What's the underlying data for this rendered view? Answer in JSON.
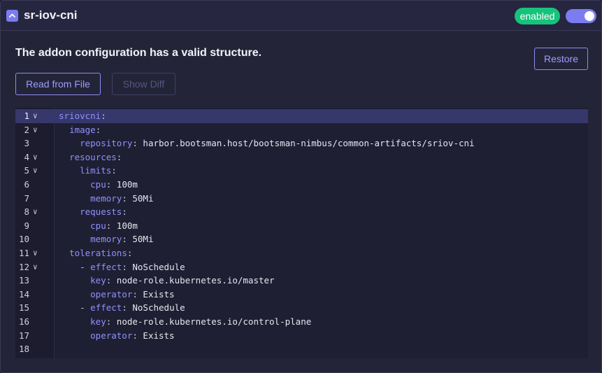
{
  "header": {
    "title": "sr-iov-cni",
    "status_badge": "enabled",
    "toggle_on": true
  },
  "message": "The addon configuration has a valid structure.",
  "buttons": {
    "restore": "Restore",
    "read_from_file": "Read from File",
    "show_diff": "Show Diff"
  },
  "editor": {
    "lines": [
      {
        "n": "1",
        "fold": true,
        "indent": "",
        "dash": "",
        "key": "sriovcni",
        "value": ""
      },
      {
        "n": "2",
        "fold": true,
        "indent": "  ",
        "dash": "",
        "key": "image",
        "value": ""
      },
      {
        "n": "3",
        "fold": false,
        "indent": "    ",
        "dash": "",
        "key": "repository",
        "value": "harbor.bootsman.host/bootsman-nimbus/common-artifacts/sriov-cni"
      },
      {
        "n": "4",
        "fold": true,
        "indent": "  ",
        "dash": "",
        "key": "resources",
        "value": ""
      },
      {
        "n": "5",
        "fold": true,
        "indent": "    ",
        "dash": "",
        "key": "limits",
        "value": ""
      },
      {
        "n": "6",
        "fold": false,
        "indent": "      ",
        "dash": "",
        "key": "cpu",
        "value": "100m"
      },
      {
        "n": "7",
        "fold": false,
        "indent": "      ",
        "dash": "",
        "key": "memory",
        "value": "50Mi"
      },
      {
        "n": "8",
        "fold": true,
        "indent": "    ",
        "dash": "",
        "key": "requests",
        "value": ""
      },
      {
        "n": "9",
        "fold": false,
        "indent": "      ",
        "dash": "",
        "key": "cpu",
        "value": "100m"
      },
      {
        "n": "10",
        "fold": false,
        "indent": "      ",
        "dash": "",
        "key": "memory",
        "value": "50Mi"
      },
      {
        "n": "11",
        "fold": true,
        "indent": "  ",
        "dash": "",
        "key": "tolerations",
        "value": ""
      },
      {
        "n": "12",
        "fold": true,
        "indent": "    ",
        "dash": "- ",
        "key": "effect",
        "value": "NoSchedule"
      },
      {
        "n": "13",
        "fold": false,
        "indent": "      ",
        "dash": "",
        "key": "key",
        "value": "node-role.kubernetes.io/master"
      },
      {
        "n": "14",
        "fold": false,
        "indent": "      ",
        "dash": "",
        "key": "operator",
        "value": "Exists"
      },
      {
        "n": "15",
        "fold": false,
        "indent": "    ",
        "dash": "- ",
        "key": "effect",
        "value": "NoSchedule"
      },
      {
        "n": "16",
        "fold": false,
        "indent": "      ",
        "dash": "",
        "key": "key",
        "value": "node-role.kubernetes.io/control-plane"
      },
      {
        "n": "17",
        "fold": false,
        "indent": "      ",
        "dash": "",
        "key": "operator",
        "value": "Exists"
      },
      {
        "n": "18",
        "fold": false,
        "indent": "",
        "dash": "",
        "key": "",
        "value": ""
      }
    ],
    "active_line": "1"
  }
}
